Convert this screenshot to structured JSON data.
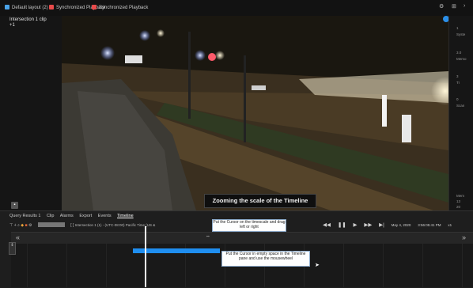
{
  "tabs": [
    {
      "label": "Default layout (2)",
      "color": "#4aa3e8"
    },
    {
      "label": "Synchronized Playback",
      "color": "#e84a4a"
    },
    {
      "label": "Synchronized Playback",
      "color": "#e84a4a"
    }
  ],
  "clip": {
    "title": "Intersection 1 clip",
    "subtitle": "+1"
  },
  "caption": "Zooming the scale of the Timeline",
  "bottom_tabs": [
    "Query Results 1",
    "Clip",
    "Alarms",
    "Export",
    "Events",
    "Timeline"
  ],
  "active_tab": "Timeline",
  "clip_info": "Intersection 1 (1) - (UTC-08:00) Pacific Time (US &",
  "playback": {
    "date": "May 4, 2020",
    "time": "3:56:05:41 PM",
    "speed": "x1"
  },
  "tooltips": {
    "tip1": "Put the Cursor on the timescale and drag left or right",
    "tip2": "Put the Cursor in empty space in the Timeline pane and use the mousewheel"
  },
  "right_panel": [
    "1",
    "Syste",
    "3.0",
    "Memo",
    "3",
    "Tr",
    "0",
    "Scan",
    "Mem",
    "13",
    "20"
  ],
  "colors": {
    "clip_bar": "#1f8ef0",
    "background": "#1b1b1b"
  }
}
